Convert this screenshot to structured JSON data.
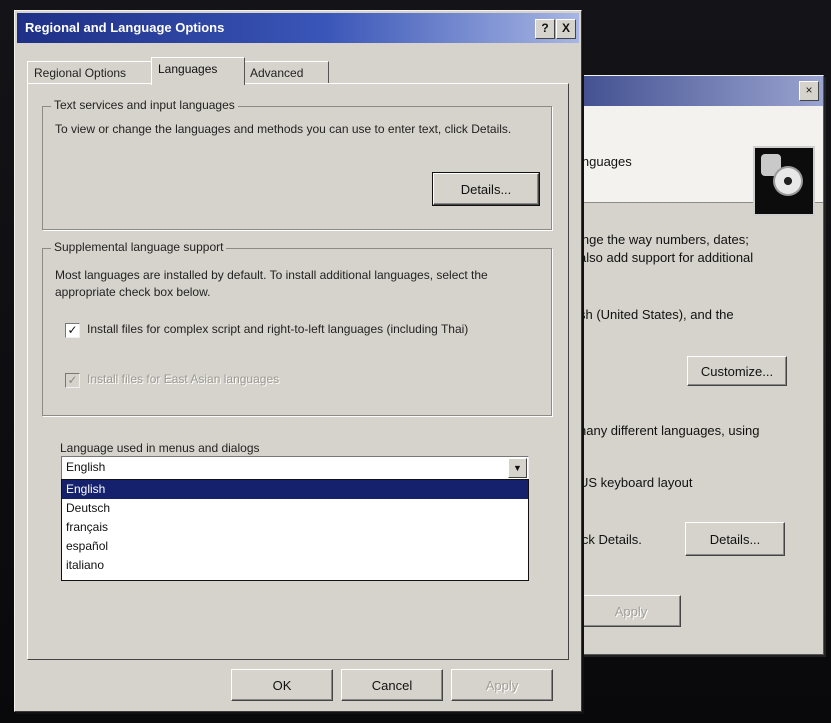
{
  "back_dialog": {
    "banner_text": "inguages",
    "line1": "inge the way numbers, dates;",
    "line2": "also add support for additional",
    "line3": "sh (United States), and the",
    "customize_label": "Customize...",
    "line4": "nany different languages, using",
    "line5": "US keyboard layout",
    "line6": "ick Details.",
    "details_label": "Details...",
    "bottom_button_label": "Apply"
  },
  "main_dialog": {
    "title": "Regional and Language Options",
    "help_button": "?",
    "close_button": "X",
    "tabs": [
      "Regional Options",
      "Languages",
      "Advanced"
    ],
    "text_services": {
      "title": "Text services and input languages",
      "description": "To view or change the languages and methods you can use to enter text, click Details.",
      "details_label": "Details..."
    },
    "supplemental": {
      "title": "Supplemental language support",
      "description": "Most languages are installed by default. To install additional languages, select the appropriate check box below.",
      "checkbox1_label": "Install files for complex script and right-to-left languages (including Thai)",
      "checkbox1_checked": true,
      "checkbox2_label": "Install files for East Asian languages",
      "checkbox2_checked": true
    },
    "menus_language": {
      "label": "Language used in menus and dialogs",
      "selected": "English",
      "options": [
        "English",
        "Deutsch",
        "français",
        "español",
        "italiano"
      ]
    },
    "buttons": {
      "ok": "OK",
      "cancel": "Cancel",
      "apply": "Apply"
    }
  },
  "colors": {
    "titlebar_start": "#1e2f86",
    "selection": "#16216e",
    "dialog_face": "#d6d3cc"
  }
}
